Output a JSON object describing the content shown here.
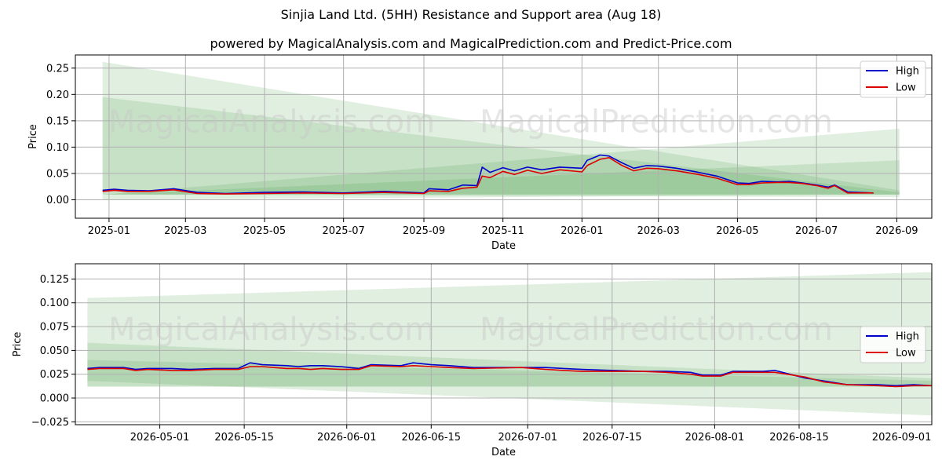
{
  "header": {
    "title": "Sinjia Land Ltd. (5HH) Resistance and Support area (Aug 18)",
    "subtitle": "powered by MagicalAnalysis.com and MagicalPrediction.com and Predict-Price.com"
  },
  "watermarks": [
    "MagicalAnalysis.com",
    "MagicalPrediction.com"
  ],
  "colors": {
    "high": "#0000cc",
    "low": "#dd0000",
    "band": "#2e8b2e",
    "grid": "#b0b0b0"
  },
  "chart_data": [
    {
      "type": "line",
      "xlabel": "Date",
      "ylabel": "Price",
      "x_ticks": [
        "2025-01",
        "2025-03",
        "2025-05",
        "2025-07",
        "2025-09",
        "2025-11",
        "2026-01",
        "2026-03",
        "2026-05",
        "2026-07",
        "2026-09"
      ],
      "x_tick_dates": [
        "2025-01-01",
        "2025-03-01",
        "2025-05-01",
        "2025-07-01",
        "2025-09-01",
        "2025-11-01",
        "2026-01-01",
        "2026-03-01",
        "2026-05-01",
        "2026-07-01",
        "2026-09-01"
      ],
      "y_ticks": [
        "0.00",
        "0.05",
        "0.10",
        "0.15",
        "0.20",
        "0.25"
      ],
      "xlim": [
        "2024-12-06",
        "2026-09-28"
      ],
      "ylim": [
        -0.035,
        0.275
      ],
      "grid": true,
      "legend_position": "top-right",
      "series": [
        {
          "name": "High",
          "points": [
            [
              "2024-12-27",
              0.018
            ],
            [
              "2025-01-05",
              0.02
            ],
            [
              "2025-01-15",
              0.018
            ],
            [
              "2025-02-01",
              0.017
            ],
            [
              "2025-02-20",
              0.021
            ],
            [
              "2025-03-10",
              0.014
            ],
            [
              "2025-04-01",
              0.012
            ],
            [
              "2025-05-01",
              0.014
            ],
            [
              "2025-06-01",
              0.015
            ],
            [
              "2025-07-01",
              0.013
            ],
            [
              "2025-08-01",
              0.016
            ],
            [
              "2025-09-01",
              0.013
            ],
            [
              "2025-09-05",
              0.021
            ],
            [
              "2025-09-20",
              0.019
            ],
            [
              "2025-10-01",
              0.028
            ],
            [
              "2025-10-12",
              0.027
            ],
            [
              "2025-10-16",
              0.062
            ],
            [
              "2025-10-22",
              0.052
            ],
            [
              "2025-11-01",
              0.061
            ],
            [
              "2025-11-10",
              0.055
            ],
            [
              "2025-11-20",
              0.062
            ],
            [
              "2025-12-01",
              0.057
            ],
            [
              "2025-12-15",
              0.062
            ],
            [
              "2026-01-01",
              0.06
            ],
            [
              "2026-01-05",
              0.075
            ],
            [
              "2026-01-15",
              0.085
            ],
            [
              "2026-01-22",
              0.083
            ],
            [
              "2026-02-01",
              0.07
            ],
            [
              "2026-02-10",
              0.06
            ],
            [
              "2026-02-20",
              0.065
            ],
            [
              "2026-03-01",
              0.064
            ],
            [
              "2026-03-15",
              0.06
            ],
            [
              "2026-04-01",
              0.052
            ],
            [
              "2026-04-15",
              0.045
            ],
            [
              "2026-05-01",
              0.032
            ],
            [
              "2026-05-10",
              0.031
            ],
            [
              "2026-05-20",
              0.035
            ],
            [
              "2026-06-01",
              0.034
            ],
            [
              "2026-06-10",
              0.035
            ],
            [
              "2026-06-20",
              0.032
            ],
            [
              "2026-07-01",
              0.028
            ],
            [
              "2026-07-10",
              0.024
            ],
            [
              "2026-07-15",
              0.028
            ],
            [
              "2026-07-25",
              0.015
            ],
            [
              "2026-08-01",
              0.014
            ],
            [
              "2026-08-14",
              0.013
            ]
          ]
        },
        {
          "name": "Low",
          "points": [
            [
              "2024-12-27",
              0.016
            ],
            [
              "2025-01-05",
              0.018
            ],
            [
              "2025-01-15",
              0.016
            ],
            [
              "2025-02-01",
              0.016
            ],
            [
              "2025-02-20",
              0.019
            ],
            [
              "2025-03-10",
              0.012
            ],
            [
              "2025-04-01",
              0.011
            ],
            [
              "2025-05-01",
              0.012
            ],
            [
              "2025-06-01",
              0.013
            ],
            [
              "2025-07-01",
              0.012
            ],
            [
              "2025-08-01",
              0.014
            ],
            [
              "2025-09-01",
              0.012
            ],
            [
              "2025-09-05",
              0.017
            ],
            [
              "2025-09-20",
              0.016
            ],
            [
              "2025-10-01",
              0.022
            ],
            [
              "2025-10-12",
              0.024
            ],
            [
              "2025-10-16",
              0.045
            ],
            [
              "2025-10-22",
              0.042
            ],
            [
              "2025-11-01",
              0.054
            ],
            [
              "2025-11-10",
              0.048
            ],
            [
              "2025-11-20",
              0.056
            ],
            [
              "2025-12-01",
              0.05
            ],
            [
              "2025-12-15",
              0.057
            ],
            [
              "2026-01-01",
              0.053
            ],
            [
              "2026-01-05",
              0.065
            ],
            [
              "2026-01-15",
              0.077
            ],
            [
              "2026-01-22",
              0.08
            ],
            [
              "2026-02-01",
              0.065
            ],
            [
              "2026-02-10",
              0.055
            ],
            [
              "2026-02-20",
              0.06
            ],
            [
              "2026-03-01",
              0.059
            ],
            [
              "2026-03-15",
              0.055
            ],
            [
              "2026-04-01",
              0.048
            ],
            [
              "2026-04-15",
              0.041
            ],
            [
              "2026-05-01",
              0.029
            ],
            [
              "2026-05-10",
              0.029
            ],
            [
              "2026-05-20",
              0.032
            ],
            [
              "2026-06-01",
              0.033
            ],
            [
              "2026-06-10",
              0.033
            ],
            [
              "2026-06-20",
              0.031
            ],
            [
              "2026-07-01",
              0.027
            ],
            [
              "2026-07-10",
              0.022
            ],
            [
              "2026-07-15",
              0.027
            ],
            [
              "2026-07-25",
              0.013
            ],
            [
              "2026-08-01",
              0.013
            ],
            [
              "2026-08-14",
              0.013
            ]
          ]
        }
      ],
      "bands": [
        {
          "x": [
            "2024-12-27",
            "2026-09-03"
          ],
          "upper": [
            0.262,
            0.018
          ],
          "lower": [
            0.01,
            0.01
          ]
        },
        {
          "x": [
            "2024-12-27",
            "2026-09-03"
          ],
          "upper": [
            0.195,
            0.014
          ],
          "lower": [
            0.0,
            0.01
          ]
        },
        {
          "x": [
            "2024-12-27",
            "2026-09-03"
          ],
          "upper": [
            0.01,
            0.135
          ],
          "lower": [
            0.01,
            0.01
          ]
        },
        {
          "x": [
            "2024-12-27",
            "2026-09-03"
          ],
          "upper": [
            0.01,
            0.075
          ],
          "lower": [
            0.01,
            0.005
          ]
        }
      ]
    },
    {
      "type": "line",
      "xlabel": "Date",
      "ylabel": "Price",
      "x_ticks": [
        "2026-05-01",
        "2026-05-15",
        "2026-06-01",
        "2026-06-15",
        "2026-07-01",
        "2026-07-15",
        "2026-08-01",
        "2026-08-15",
        "2026-09-01"
      ],
      "y_ticks": [
        "−0.025",
        "0.000",
        "0.025",
        "0.050",
        "0.075",
        "0.100",
        "0.125"
      ],
      "xlim": [
        "2026-04-17",
        "2026-09-06"
      ],
      "ylim": [
        -0.028,
        0.141
      ],
      "grid": true,
      "legend_position": "center-right",
      "series": [
        {
          "name": "High",
          "points": [
            [
              "2026-04-19",
              0.031
            ],
            [
              "2026-04-21",
              0.032
            ],
            [
              "2026-04-25",
              0.032
            ],
            [
              "2026-04-27",
              0.03
            ],
            [
              "2026-04-29",
              0.031
            ],
            [
              "2026-05-03",
              0.031
            ],
            [
              "2026-05-06",
              0.03
            ],
            [
              "2026-05-10",
              0.031
            ],
            [
              "2026-05-14",
              0.031
            ],
            [
              "2026-05-16",
              0.037
            ],
            [
              "2026-05-18",
              0.035
            ],
            [
              "2026-05-22",
              0.034
            ],
            [
              "2026-05-24",
              0.033
            ],
            [
              "2026-05-26",
              0.034
            ],
            [
              "2026-05-28",
              0.034
            ],
            [
              "2026-05-31",
              0.033
            ],
            [
              "2026-06-03",
              0.031
            ],
            [
              "2026-06-05",
              0.035
            ],
            [
              "2026-06-10",
              0.034
            ],
            [
              "2026-06-12",
              0.037
            ],
            [
              "2026-06-15",
              0.035
            ],
            [
              "2026-06-18",
              0.034
            ],
            [
              "2026-06-22",
              0.032
            ],
            [
              "2026-06-30",
              0.032
            ],
            [
              "2026-07-04",
              0.032
            ],
            [
              "2026-07-07",
              0.031
            ],
            [
              "2026-07-10",
              0.03
            ],
            [
              "2026-07-20",
              0.028
            ],
            [
              "2026-07-24",
              0.028
            ],
            [
              "2026-07-28",
              0.027
            ],
            [
              "2026-07-30",
              0.024
            ],
            [
              "2026-08-02",
              0.024
            ],
            [
              "2026-08-04",
              0.028
            ],
            [
              "2026-08-09",
              0.028
            ],
            [
              "2026-08-11",
              0.029
            ],
            [
              "2026-08-16",
              0.021
            ],
            [
              "2026-08-19",
              0.018
            ],
            [
              "2026-08-23",
              0.014
            ],
            [
              "2026-08-28",
              0.014
            ],
            [
              "2026-08-31",
              0.013
            ],
            [
              "2026-09-03",
              0.014
            ],
            [
              "2026-09-06",
              0.013
            ],
            [
              "2026-09-09",
              0.014
            ],
            [
              "2026-09-14",
              0.014
            ],
            [
              "2026-09-16",
              0.013
            ]
          ]
        },
        {
          "name": "Low",
          "points": [
            [
              "2026-04-19",
              0.03
            ],
            [
              "2026-04-21",
              0.031
            ],
            [
              "2026-04-25",
              0.031
            ],
            [
              "2026-04-27",
              0.029
            ],
            [
              "2026-04-29",
              0.03
            ],
            [
              "2026-05-03",
              0.029
            ],
            [
              "2026-05-06",
              0.029
            ],
            [
              "2026-05-10",
              0.03
            ],
            [
              "2026-05-14",
              0.03
            ],
            [
              "2026-05-16",
              0.033
            ],
            [
              "2026-05-18",
              0.033
            ],
            [
              "2026-05-22",
              0.031
            ],
            [
              "2026-05-24",
              0.031
            ],
            [
              "2026-05-26",
              0.03
            ],
            [
              "2026-05-28",
              0.031
            ],
            [
              "2026-05-31",
              0.03
            ],
            [
              "2026-06-03",
              0.03
            ],
            [
              "2026-06-05",
              0.034
            ],
            [
              "2026-06-10",
              0.033
            ],
            [
              "2026-06-12",
              0.034
            ],
            [
              "2026-06-15",
              0.033
            ],
            [
              "2026-06-18",
              0.032
            ],
            [
              "2026-06-22",
              0.031
            ],
            [
              "2026-06-30",
              0.032
            ],
            [
              "2026-07-04",
              0.03
            ],
            [
              "2026-07-07",
              0.029
            ],
            [
              "2026-07-10",
              0.028
            ],
            [
              "2026-07-20",
              0.028
            ],
            [
              "2026-07-24",
              0.027
            ],
            [
              "2026-07-28",
              0.025
            ],
            [
              "2026-07-30",
              0.023
            ],
            [
              "2026-08-02",
              0.023
            ],
            [
              "2026-08-04",
              0.027
            ],
            [
              "2026-08-09",
              0.027
            ],
            [
              "2026-08-11",
              0.027
            ],
            [
              "2026-08-16",
              0.022
            ],
            [
              "2026-08-19",
              0.017
            ],
            [
              "2026-08-23",
              0.014
            ],
            [
              "2026-08-28",
              0.013
            ],
            [
              "2026-08-31",
              0.012
            ],
            [
              "2026-09-03",
              0.013
            ],
            [
              "2026-09-06",
              0.013
            ],
            [
              "2026-09-09",
              0.014
            ],
            [
              "2026-09-14",
              0.014
            ],
            [
              "2026-09-16",
              0.013
            ]
          ]
        }
      ],
      "bands": [
        {
          "x": [
            "2026-04-19",
            "2026-09-20"
          ],
          "upper": [
            0.105,
            0.135
          ],
          "lower": [
            0.012,
            0.012
          ]
        },
        {
          "x": [
            "2026-04-19",
            "2026-09-20"
          ],
          "upper": [
            0.058,
            0.017
          ],
          "lower": [
            0.012,
            0.012
          ]
        },
        {
          "x": [
            "2026-04-19",
            "2026-09-20"
          ],
          "upper": [
            0.04,
            0.016
          ],
          "lower": [
            0.018,
            -0.022
          ]
        }
      ]
    }
  ]
}
